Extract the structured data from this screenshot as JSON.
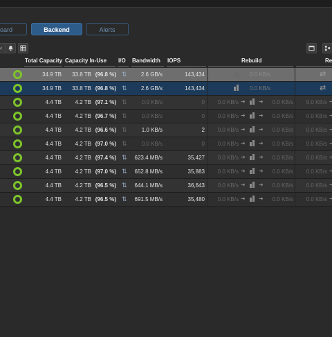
{
  "tabs": [
    {
      "label": "oard"
    },
    {
      "label": "Backend"
    },
    {
      "label": "Alerts"
    }
  ],
  "toolbar": {
    "icons": [
      "chevron-left-icon",
      "bell-icon",
      "table-icon",
      "window-icon",
      "columns-icon"
    ]
  },
  "columns": {
    "total_capacity": "Total Capacity",
    "capacity_in_use": "Capacity In-Use",
    "io": "I/O",
    "bandwidth": "Bandwidth",
    "iops": "IOPS",
    "rebuild": "Rebuild",
    "re": "Re"
  },
  "colors": {
    "status_ring": "#7dc42c",
    "active_tab": "#2d5b8a",
    "selected_row": "#1c3a5a"
  },
  "rows": [
    {
      "total": "34.9 TB",
      "inuse": "33.8 TB",
      "pct": "(96.8 %)",
      "bw": "2.6 GB/s",
      "iops": "143,434",
      "r1": "",
      "r2": "0.0 KB/s",
      "r3": "",
      "style": "grey",
      "io_active": true
    },
    {
      "total": "34.9 TB",
      "inuse": "33.8 TB",
      "pct": "(96.8 %)",
      "bw": "2.6 GB/s",
      "iops": "143,434",
      "r1": "",
      "r2": "0.0 KB/s",
      "r3": "",
      "style": "sel",
      "io_active": true
    },
    {
      "total": "4.4 TB",
      "inuse": "4.2 TB",
      "pct": "(97.1 %)",
      "bw": "0.0 KB/s",
      "iops": "0",
      "r1": "0.0 KB/s",
      "r2": "0.0 KB/s",
      "r3": "0.0 KB/s",
      "style": "odd",
      "io_active": false
    },
    {
      "total": "4.4 TB",
      "inuse": "4.2 TB",
      "pct": "(96.7 %)",
      "bw": "0.0 KB/s",
      "iops": "0",
      "r1": "0.0 KB/s",
      "r2": "0.0 KB/s",
      "r3": "0.0 KB/s",
      "style": "even",
      "io_active": false
    },
    {
      "total": "4.4 TB",
      "inuse": "4.2 TB",
      "pct": "(96.6 %)",
      "bw": "1.0 KB/s",
      "iops": "2",
      "r1": "0.0 KB/s",
      "r2": "0.0 KB/s",
      "r3": "0.0 KB/s",
      "style": "odd",
      "io_active": false
    },
    {
      "total": "4.4 TB",
      "inuse": "4.2 TB",
      "pct": "(97.0 %)",
      "bw": "0.0 KB/s",
      "iops": "0",
      "r1": "0.0 KB/s",
      "r2": "0.0 KB/s",
      "r3": "0.0 KB/s",
      "style": "even",
      "io_active": false
    },
    {
      "total": "4.4 TB",
      "inuse": "4.2 TB",
      "pct": "(97.4 %)",
      "bw": "623.4 MB/s",
      "iops": "35,427",
      "r1": "0.0 KB/s",
      "r2": "0.0 KB/s",
      "r3": "0.0 KB/s",
      "style": "odd",
      "io_active": true
    },
    {
      "total": "4.4 TB",
      "inuse": "4.2 TB",
      "pct": "(97.0 %)",
      "bw": "652.8 MB/s",
      "iops": "35,883",
      "r1": "0.0 KB/s",
      "r2": "0.0 KB/s",
      "r3": "0.0 KB/s",
      "style": "even",
      "io_active": true
    },
    {
      "total": "4.4 TB",
      "inuse": "4.2 TB",
      "pct": "(96.5 %)",
      "bw": "644.1 MB/s",
      "iops": "36,643",
      "r1": "0.0 KB/s",
      "r2": "0.0 KB/s",
      "r3": "0.0 KB/s",
      "style": "odd",
      "io_active": true
    },
    {
      "total": "4.4 TB",
      "inuse": "4.2 TB",
      "pct": "(96.5 %)",
      "bw": "691.5 MB/s",
      "iops": "35,480",
      "r1": "0.0 KB/s",
      "r2": "0.0 KB/s",
      "r3": "0.0 KB/s",
      "style": "even",
      "io_active": true
    }
  ]
}
